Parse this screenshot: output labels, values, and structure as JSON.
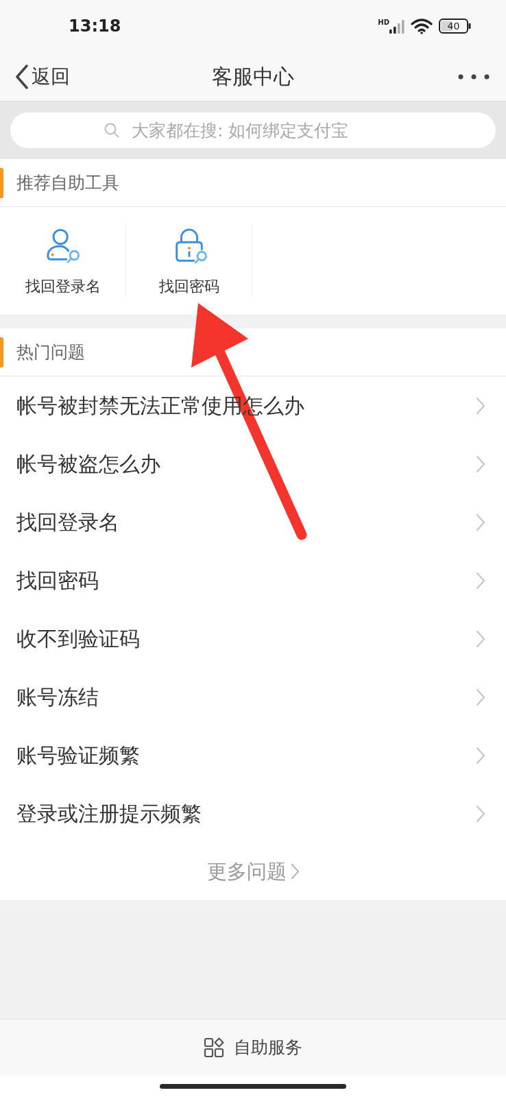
{
  "status_bar": {
    "time": "13:18",
    "network_type": "HD",
    "battery": "40"
  },
  "nav_bar": {
    "back_label": "返回",
    "title": "客服中心"
  },
  "search": {
    "placeholder": "大家都在搜: 如何绑定支付宝"
  },
  "tools_section": {
    "title": "推荐自助工具",
    "tools": [
      {
        "kind": "person",
        "label": "找回登录名"
      },
      {
        "kind": "lock",
        "label": "找回密码"
      }
    ]
  },
  "questions_section": {
    "title": "热门问题",
    "questions": [
      "帐号被封禁无法正常使用怎么办",
      "帐号被盗怎么办",
      "找回登录名",
      "找回密码",
      "收不到验证码",
      "账号冻结",
      "账号验证频繁",
      "登录或注册提示频繁"
    ],
    "more_label": "更多问题"
  },
  "bottom_bar": {
    "label": "自助服务"
  }
}
